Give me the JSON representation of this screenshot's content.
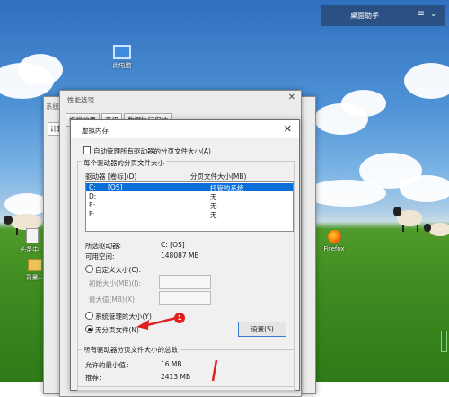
{
  "assistant": {
    "title": "桌面助手",
    "menu_icon": "menu-icon",
    "chevron_icon": "chevron-down-icon"
  },
  "desktop_icons": {
    "computer": "此电脑",
    "item_left": "头条中...",
    "item_left2": "背景...",
    "firefox": "Firefox"
  },
  "sys_window": {
    "title": "系统...",
    "tab": "计算..."
  },
  "perf_window": {
    "title": "性能选项",
    "tabs": [
      "视觉效果",
      "高级",
      "数据执行保护"
    ]
  },
  "vm_dialog": {
    "title": "虚拟内存",
    "auto_manage_label": "自动管理所有驱动器的分页文件大小(A)",
    "group_label": "每个驱动器的分页文件大小",
    "col_drive": "驱动器 [卷标](D)",
    "col_size": "分页文件大小(MB)",
    "drives": [
      {
        "drive": "C:",
        "label": "[OS]",
        "size": "托管的系统"
      },
      {
        "drive": "D:",
        "label": "",
        "size": "无"
      },
      {
        "drive": "E:",
        "label": "",
        "size": "无"
      },
      {
        "drive": "F:",
        "label": "",
        "size": "无"
      }
    ],
    "selected_drive_label": "所选驱动器:",
    "selected_drive_value": "C:  [OS]",
    "free_space_label": "可用空间:",
    "free_space_value": "148087 MB",
    "custom_size_label": "自定义大小(C):",
    "initial_size_label": "初始大小(MB)(I):",
    "max_size_label": "最大值(MB)(X):",
    "system_managed_label": "系统管理的大小(Y)",
    "no_paging_label": "无分页文件(N)",
    "set_button": "设置(S)",
    "total_group_label": "所有驱动器分页文件大小的总数",
    "min_allowed_label": "允许的最小值:",
    "min_allowed_value": "16 MB",
    "recommended_label": "推荐:",
    "recommended_value": "2413 MB",
    "selected_radio": "no_paging",
    "annotation_number": "1",
    "annotation_color": "#e02020"
  }
}
